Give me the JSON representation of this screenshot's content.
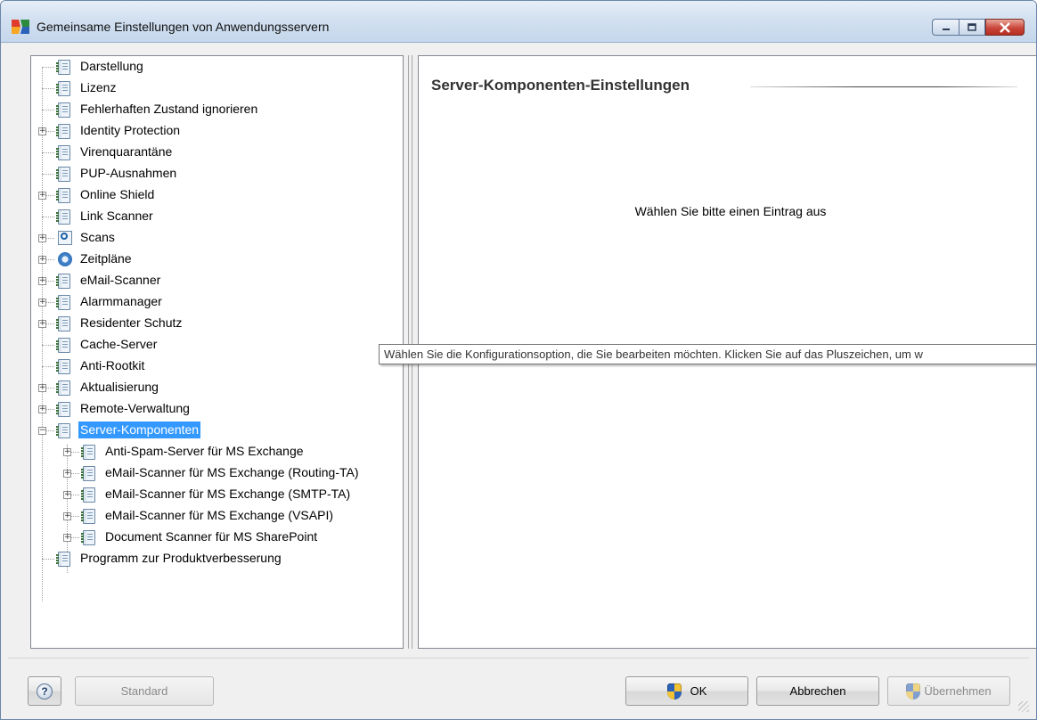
{
  "window": {
    "title": "Gemeinsame Einstellungen von Anwendungsservern",
    "caption_buttons": [
      "minimize-icon",
      "maximize-icon",
      "close-icon"
    ]
  },
  "tree": {
    "items": [
      {
        "label": "Darstellung",
        "icon": "doc-icon",
        "expandable": false
      },
      {
        "label": "Lizenz",
        "icon": "doc-icon",
        "expandable": false
      },
      {
        "label": "Fehlerhaften Zustand ignorieren",
        "icon": "doc-icon",
        "expandable": false
      },
      {
        "label": "Identity Protection",
        "icon": "doc-icon",
        "expandable": true
      },
      {
        "label": "Virenquarantäne",
        "icon": "doc-icon",
        "expandable": false
      },
      {
        "label": "PUP-Ausnahmen",
        "icon": "doc-icon",
        "expandable": false
      },
      {
        "label": "Online Shield",
        "icon": "doc-icon",
        "expandable": true
      },
      {
        "label": "Link Scanner",
        "icon": "doc-icon",
        "expandable": false
      },
      {
        "label": "Scans",
        "icon": "scan-icon",
        "expandable": true
      },
      {
        "label": "Zeitpläne",
        "icon": "schedule-icon",
        "expandable": true
      },
      {
        "label": "eMail-Scanner",
        "icon": "doc-icon",
        "expandable": true
      },
      {
        "label": "Alarmmanager",
        "icon": "doc-icon",
        "expandable": true
      },
      {
        "label": "Residenter Schutz",
        "icon": "doc-icon",
        "expandable": true
      },
      {
        "label": "Cache-Server",
        "icon": "doc-icon",
        "expandable": false
      },
      {
        "label": "Anti-Rootkit",
        "icon": "doc-icon",
        "expandable": false
      },
      {
        "label": "Aktualisierung",
        "icon": "doc-icon",
        "expandable": true
      },
      {
        "label": "Remote-Verwaltung",
        "icon": "doc-icon",
        "expandable": true
      },
      {
        "label": "Server-Komponenten",
        "icon": "doc-icon",
        "expandable": true,
        "expanded": true,
        "selected": true
      },
      {
        "label": "Anti-Spam-Server für MS Exchange",
        "icon": "doc-icon",
        "expandable": true,
        "child": true
      },
      {
        "label": "eMail-Scanner für MS Exchange (Routing-TA)",
        "icon": "doc-icon",
        "expandable": true,
        "child": true
      },
      {
        "label": "eMail-Scanner für MS Exchange (SMTP-TA)",
        "icon": "doc-icon",
        "expandable": true,
        "child": true
      },
      {
        "label": "eMail-Scanner für MS Exchange (VSAPI)",
        "icon": "doc-icon",
        "expandable": true,
        "child": true
      },
      {
        "label": "Document Scanner für MS SharePoint",
        "icon": "doc-icon",
        "expandable": true,
        "child": true
      },
      {
        "label": "Programm zur Produktverbesserung",
        "icon": "doc-icon",
        "expandable": false
      }
    ]
  },
  "panel": {
    "heading": "Server-Komponenten-Einstellungen",
    "empty_message": "Wählen Sie bitte einen Eintrag aus"
  },
  "tooltip": {
    "text": "Wählen Sie die Konfigurationsoption, die Sie bearbeiten möchten. Klicken Sie auf das Pluszeichen, um w"
  },
  "buttons": {
    "help_icon": "?",
    "standard": "Standard",
    "ok": "OK",
    "cancel": "Abbrechen",
    "apply": "Übernehmen"
  },
  "colors": {
    "selection": "#3399ff",
    "titlebar": "#c5d7ec"
  }
}
